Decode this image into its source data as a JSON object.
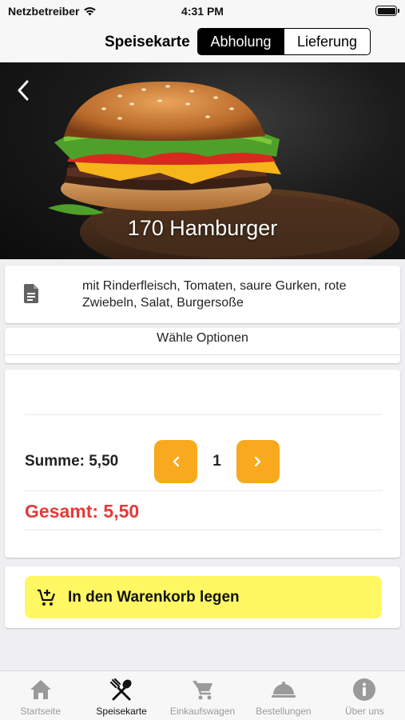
{
  "status_bar": {
    "carrier": "Netzbetreiber",
    "time": "4:31 PM"
  },
  "nav": {
    "title": "Speisekarte",
    "segments": [
      {
        "label": "Abholung",
        "selected": true
      },
      {
        "label": "Lieferung",
        "selected": false
      }
    ]
  },
  "product": {
    "title": "170 Hamburger",
    "description": "mit Rinderfleisch, Tomaten, saure Gurken, rote Zwiebeln, Salat, Burgersoße",
    "options_label": "Wähle Optionen"
  },
  "order": {
    "summe": "Summe: 5,50",
    "quantity": "1",
    "gesamt": "Gesamt: 5,50"
  },
  "cart_button": {
    "label": "In den Warenkorb legen"
  },
  "tab_bar": {
    "items": [
      {
        "label": "Startseite",
        "icon": "home-icon"
      },
      {
        "label": "Speisekarte",
        "icon": "cutlery-icon"
      },
      {
        "label": "Einkaufswagen",
        "icon": "cart-icon"
      },
      {
        "label": "Bestellungen",
        "icon": "cloche-icon"
      },
      {
        "label": "Über uns",
        "icon": "info-icon"
      }
    ],
    "active_index": 1
  },
  "colors": {
    "accent": "#f8a91d",
    "total": "#e43a3a",
    "cart_button": "#fff862"
  }
}
